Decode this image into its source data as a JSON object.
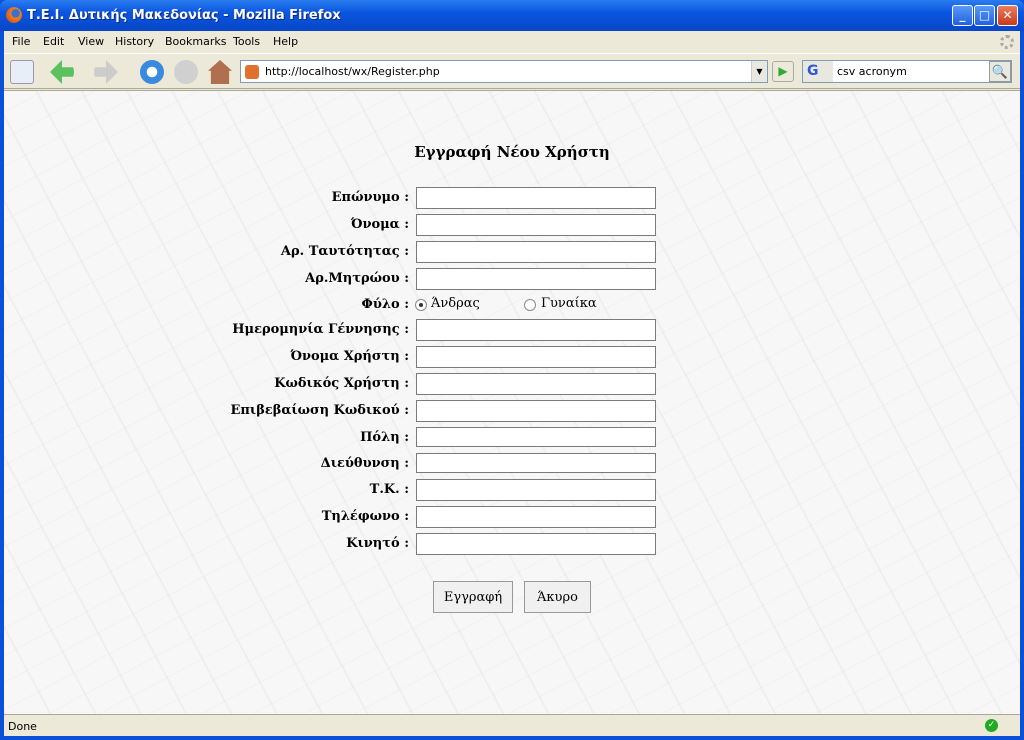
{
  "window": {
    "title": "Τ.Ε.Ι. Δυτικής Μακεδονίας - Mozilla Firefox",
    "minimize": "_",
    "maximize": "□",
    "close": "✕"
  },
  "menu": [
    "File",
    "Edit",
    "View",
    "History",
    "Bookmarks",
    "Tools",
    "Help"
  ],
  "navbar": {
    "url": "http://localhost/wx/Register.php",
    "search_value": "csv acronym",
    "search_engine": "G",
    "icons": [
      "new-tab-icon",
      "back-icon",
      "forward-icon",
      "reload-icon",
      "stop-icon",
      "home-icon",
      "go-icon",
      "search-icon"
    ]
  },
  "form": {
    "title": "Εγγραφή Νέου Χρήστη",
    "fields": [
      {
        "label": "Επώνυμο :",
        "value": ""
      },
      {
        "label": "Όνομα :",
        "value": ""
      },
      {
        "label": "Αρ. Ταυτότητας :",
        "value": ""
      },
      {
        "label": "Αρ.Μητρώου :",
        "value": ""
      },
      {
        "label": "Ημερομηνία Γέννησης :",
        "value": ""
      },
      {
        "label": "Όνομα Χρήστη :",
        "value": ""
      },
      {
        "label": "Κωδικός Χρήστη :",
        "value": ""
      },
      {
        "label": "Επιβεβαίωση Κωδικού :",
        "value": ""
      },
      {
        "label": "Πόλη :",
        "value": ""
      },
      {
        "label": "Διεύθυνση :",
        "value": ""
      },
      {
        "label": "Τ.Κ. :",
        "value": ""
      },
      {
        "label": "Τηλέφωνο :",
        "value": ""
      },
      {
        "label": "Κινητό :",
        "value": ""
      }
    ],
    "gender": {
      "label": "Φύλο :",
      "options": [
        "Άνδρας",
        "Γυναίκα"
      ],
      "selected": "Άνδρας"
    },
    "submit": "Εγγραφή",
    "cancel": "Άκυρο"
  },
  "status": {
    "text": "Done"
  }
}
